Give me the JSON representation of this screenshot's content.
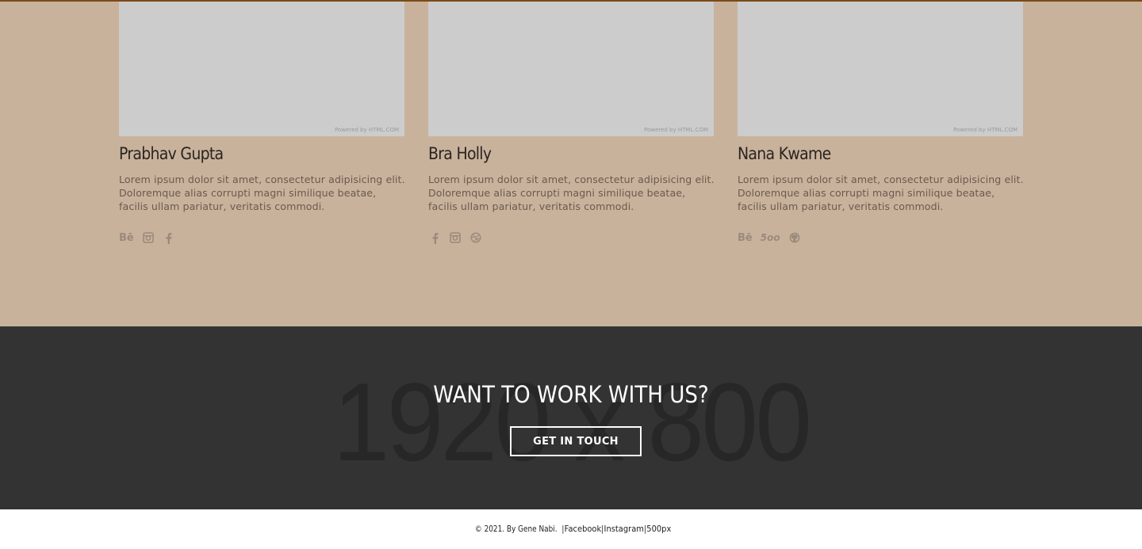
{
  "team": {
    "members": [
      {
        "name": "Prabhav Gupta",
        "photo_credit": "Powered by HTML.COM",
        "description": "Lorem ipsum dolor sit amet, consectetur adipisicing elit. Doloremque alias corrupti magni similique beatae, facilis ullam pariatur, veritatis commodi.",
        "socials": [
          "behance-icon",
          "instagram-icon",
          "facebook-icon"
        ]
      },
      {
        "name": "Bra Holly",
        "photo_credit": "Powered by HTML.COM",
        "description": "Lorem ipsum dolor sit amet, consectetur adipisicing elit. Doloremque alias corrupti magni similique beatae, facilis ullam pariatur, veritatis commodi.",
        "socials": [
          "facebook-icon",
          "instagram-icon",
          "dribbble-icon"
        ]
      },
      {
        "name": "Nana Kwame",
        "photo_credit": "Powered by HTML.COM",
        "description": "Lorem ipsum dolor sit amet, consectetur adipisicing elit. Doloremque alias corrupti magni similique beatae, facilis ullam pariatur, veritatis commodi.",
        "socials": [
          "behance-icon",
          "500px-icon",
          "github-icon"
        ]
      }
    ],
    "icon_glyphs": {
      "behance": "Bē",
      "500px": "5oo"
    }
  },
  "cta": {
    "background_text": "1920 x 800",
    "title": "WANT TO WORK WITH US?",
    "button_label": "GET IN TOUCH"
  },
  "footer": {
    "copyright": "© 2021. By Gene Nabi.",
    "links": [
      "Facebook",
      "Instagram",
      "500px"
    ],
    "separator": " | "
  },
  "colors": {
    "top_bar": "#7a4a17",
    "team_background": "#c9b29c",
    "photo_placeholder": "#cccccc",
    "cta_background": "#333333"
  }
}
